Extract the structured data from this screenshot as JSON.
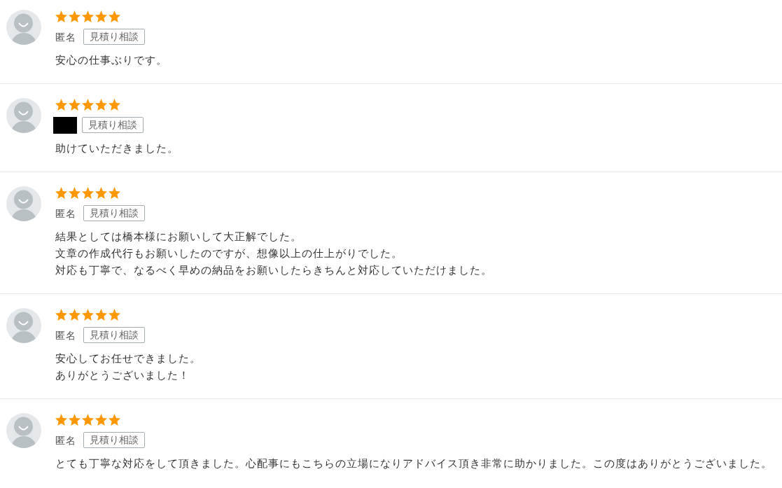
{
  "reviews": [
    {
      "stars": 5,
      "author": "匿名",
      "redacted": false,
      "tag": "見積り相談",
      "comment": [
        "安心の仕事ぶりです。"
      ]
    },
    {
      "stars": 5,
      "redacted": true,
      "tag": "見積り相談",
      "comment": [
        "助けていただきました。"
      ]
    },
    {
      "stars": 5,
      "author": "匿名",
      "redacted": false,
      "tag": "見積り相談",
      "comment": [
        "結果としては橋本様にお願いして大正解でした。",
        "文章の作成代行もお願いしたのですが、想像以上の仕上がりでした。",
        "対応も丁寧で、なるべく早めの納品をお願いしたらきちんと対応していただけました。"
      ]
    },
    {
      "stars": 5,
      "author": "匿名",
      "redacted": false,
      "tag": "見積り相談",
      "comment": [
        "安心してお任せできました。",
        "ありがとうございました！"
      ]
    },
    {
      "stars": 5,
      "author": "匿名",
      "redacted": false,
      "tag": "見積り相談",
      "comment": [
        "とても丁寧な対応をして頂きました。心配事にもこちらの立場になりアドバイス頂き非常に助かりました。この度はありがとうございました。"
      ]
    }
  ]
}
